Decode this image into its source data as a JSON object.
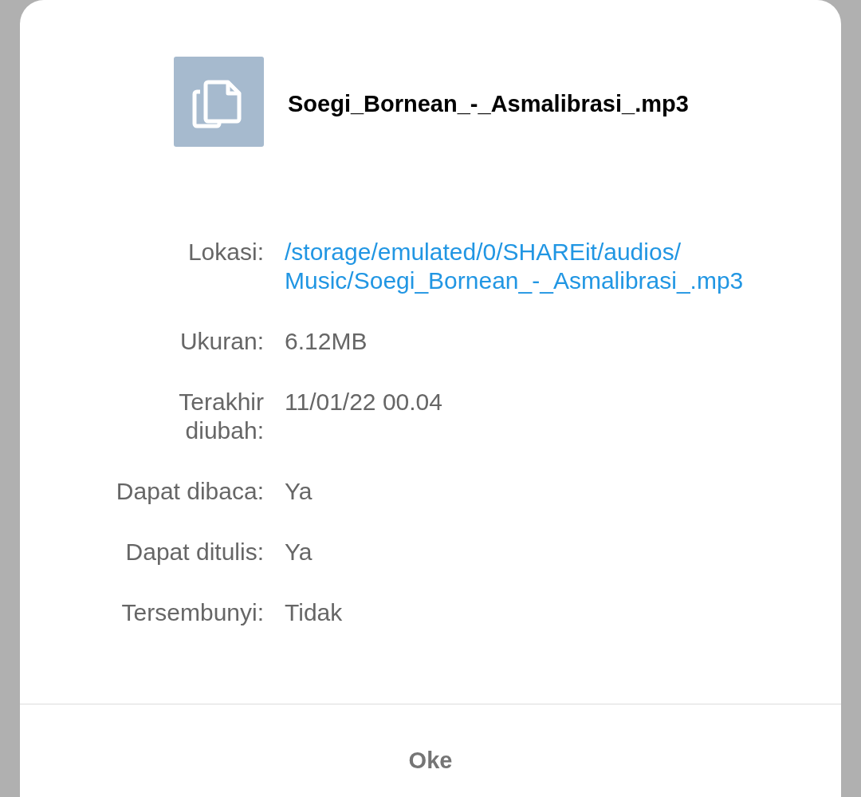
{
  "header": {
    "file_name": "Soegi_Bornean_-_Asmalibrasi_.mp3"
  },
  "details": [
    {
      "label": "Lokasi:",
      "value": "/storage/emulated/0/SHAREit/audios/Music/Soegi_Bornean_-_Asmalibrasi_.mp3",
      "kind": "link"
    },
    {
      "label": "Ukuran:",
      "value": "6.12MB",
      "kind": "text"
    },
    {
      "label": "Terakhir diubah:",
      "value": "11/01/22 00.04",
      "kind": "text"
    },
    {
      "label": "Dapat dibaca:",
      "value": "Ya",
      "kind": "text"
    },
    {
      "label": "Dapat ditulis:",
      "value": "Ya",
      "kind": "text"
    },
    {
      "label": "Tersembunyi:",
      "value": "Tidak",
      "kind": "text"
    }
  ],
  "buttons": [
    {
      "label": "Oke"
    }
  ]
}
